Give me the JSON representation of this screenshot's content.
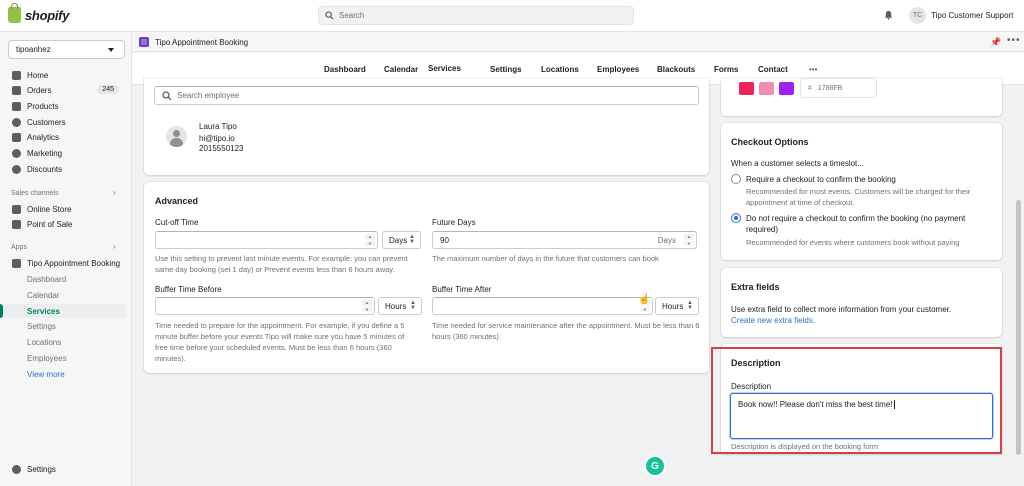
{
  "topbar": {
    "brand": "shopify",
    "search_placeholder": "Search",
    "user_initials": "TC",
    "user_name": "Tipo Customer Support"
  },
  "sidebar": {
    "store": "tipoanhez",
    "items": [
      {
        "label": "Home"
      },
      {
        "label": "Orders",
        "badge": "245"
      },
      {
        "label": "Products"
      },
      {
        "label": "Customers"
      },
      {
        "label": "Analytics"
      },
      {
        "label": "Marketing"
      },
      {
        "label": "Discounts"
      }
    ],
    "sales_channels_label": "Sales channels",
    "sales_channels": [
      {
        "label": "Online Store"
      },
      {
        "label": "Point of Sale"
      }
    ],
    "apps_label": "Apps",
    "app_name": "Tipo Appointment Booking",
    "app_subitems": [
      "Dashboard",
      "Calendar",
      "Services",
      "Settings",
      "Locations",
      "Employees"
    ],
    "view_more": "View more",
    "settings": "Settings"
  },
  "app_header": {
    "title": "Tipo Appointment Booking"
  },
  "tabs": [
    "Dashboard",
    "Calendar",
    "Services",
    "Settings",
    "Locations",
    "Employees",
    "Blackouts",
    "Forms",
    "Contact"
  ],
  "active_tab": "Services",
  "employee": {
    "search_placeholder": "Search employee",
    "name": "Laura Tipo",
    "email": "hi@tipo.io",
    "phone": "2015550123"
  },
  "advanced": {
    "title": "Advanced",
    "cutoff_label": "Cut-off Time",
    "cutoff_value": "",
    "cutoff_unit": "Days",
    "cutoff_help": "Use this setting to prevent last minute events. For example: you can prevent same day booking (set 1 day) or Prevent events less than 6 hours away.",
    "future_label": "Future Days",
    "future_value": "90",
    "future_suffix": "Days",
    "future_help": "The maximum number of days in the future that customers can book",
    "buffer_before_label": "Buffer Time Before",
    "buffer_before_value": "",
    "buffer_before_unit": "Hours",
    "buffer_before_help": "Time needed to prepare for the appointment. For example, if you define a 5 minute buffer before your events Tipo will make sure you have 5 minutes of free time before your scheduled events. Must be less than 6 hours (360 minutes).",
    "buffer_after_label": "Buffer Time After",
    "buffer_after_value": "",
    "buffer_after_unit": "Hours",
    "buffer_after_help": "Time needed for service maintenance after the appointment. Must be less than 6 hours (360 minutes)."
  },
  "colors": {
    "hash": "#",
    "hex_value": "1788FB",
    "swatches": [
      "#f0245b",
      "#f28db0",
      "#a020f0"
    ],
    "accent": "#008060",
    "link": "#2c6ecb"
  },
  "checkout": {
    "title": "Checkout Options",
    "intro": "When a customer selects a timeslot...",
    "option1_label": "Require a checkout to confirm the booking",
    "option1_help": "Recommended for most events. Customers will be charged for their appointment at time of checkout.",
    "option2_label": "Do not require a checkout to confirm the booking (no payment required)",
    "option2_help": "Recommended for events where customers book without paying",
    "selected": 2
  },
  "extra_fields": {
    "title": "Extra fields",
    "text": "Use extra field to collect more information from your customer.",
    "link": "Create new extra fields."
  },
  "description": {
    "title": "Description",
    "label": "Description",
    "value": "Book now!! Please don't miss the best time!",
    "help": "Description is displayed on the booking form"
  },
  "grammarly_letter": "G"
}
